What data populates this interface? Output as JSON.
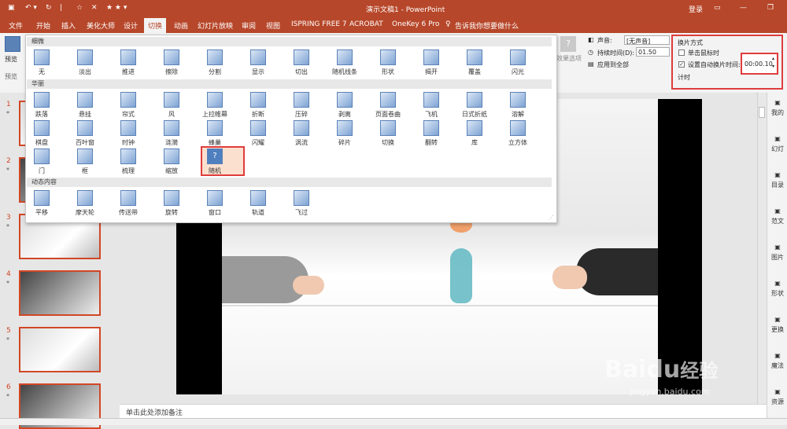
{
  "titlebar": {
    "doc_title": "演示文稿1 - PowerPoint",
    "login": "登录",
    "qat": [
      "save-icon",
      "undo-icon",
      "redo-icon",
      "slideshow-icon",
      "magic-icon",
      "star-icon"
    ]
  },
  "tabs": [
    "文件",
    "开始",
    "插入",
    "美化大师",
    "设计",
    "切换",
    "动画",
    "幻灯片放映",
    "审阅",
    "视图",
    "ISPRING FREE 7",
    "ACROBAT",
    "OneKey 6 Pro"
  ],
  "tell_me": "告诉我你想要做什么",
  "ribbon": {
    "preview": "预览",
    "preview_group": "预览",
    "effect_options": "效果选项",
    "sound_label": "声音:",
    "sound_value": "[无声音]",
    "duration_label": "持续时间(D):",
    "duration_value": "01.50",
    "apply_all": "应用到全部",
    "advance_title": "换片方式",
    "on_click": "单击鼠标时",
    "after_time": "设置自动换片时间:",
    "after_time_value": "00:00.10",
    "timing_group": "计时",
    "on_click_checked": false,
    "after_time_checked": true
  },
  "gallery": {
    "sections": [
      {
        "title": "细微",
        "items": [
          "无",
          "淡出",
          "推进",
          "擦除",
          "分割",
          "显示",
          "切出",
          "随机线条",
          "形状",
          "揭开",
          "覆盖",
          "闪光"
        ]
      },
      {
        "title": "华丽",
        "items": [
          "跌落",
          "悬挂",
          "帘式",
          "风",
          "上拉帷幕",
          "折断",
          "压碎",
          "剥离",
          "页面卷曲",
          "飞机",
          "日式折纸",
          "溶解",
          "棋盘",
          "百叶窗",
          "时钟",
          "涟漪",
          "蜂巢",
          "闪耀",
          "涡流",
          "碎片",
          "切换",
          "翻转",
          "库",
          "立方体",
          "门",
          "框",
          "梳理",
          "缩放",
          "随机"
        ]
      },
      {
        "title": "动态内容",
        "items": [
          "平移",
          "摩天轮",
          "传送带",
          "旋转",
          "窗口",
          "轨道",
          "飞过"
        ]
      }
    ],
    "selected": "随机",
    "random_glyph": "?"
  },
  "slides": [
    "1",
    "2",
    "3",
    "4",
    "5",
    "6"
  ],
  "slide_star": "*",
  "notes_placeholder": "单击此处添加备注",
  "right_pane": [
    "我的",
    "幻灯",
    "目录",
    "范文",
    "图片",
    "形状",
    "更换",
    "魔法",
    "资源"
  ],
  "watermark": {
    "brand": "Baidu",
    "cn": "经验",
    "url": "jingyan.baidu.com"
  },
  "colors": {
    "accent": "#b7472a",
    "highlight": "#e03c3c",
    "thumb_border": "#d24726"
  }
}
